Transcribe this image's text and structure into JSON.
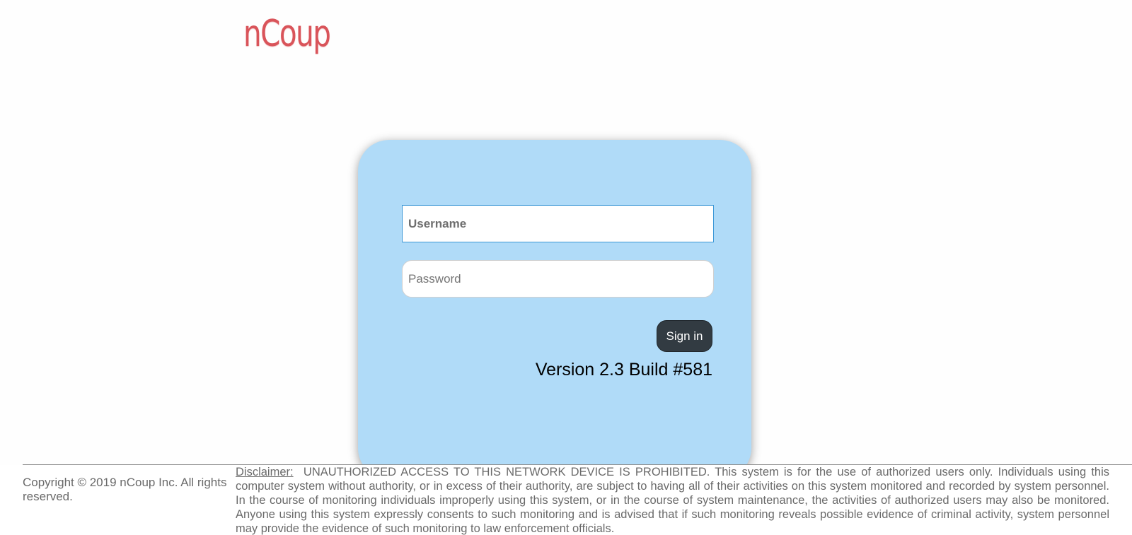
{
  "brand": {
    "logo_text": "nCoup",
    "logo_color": "#d9545a"
  },
  "login": {
    "username_placeholder": "Username",
    "password_placeholder": "Password",
    "signin_label": "Sign in",
    "version_text": "Version 2.3 Build #581",
    "card_color": "#b0dbf8",
    "button_color": "#323b42"
  },
  "footer": {
    "copyright": "Copyright © 2019 nCoup Inc. All rights reserved.",
    "disclaimer_label": "Disclaimer:",
    "disclaimer_text": "UNAUTHORIZED ACCESS TO THIS NETWORK DEVICE IS PROHIBITED.  This system is for the use of authorized users only. Individuals using this computer system without authority, or in excess of their authority, are subject to having all of their activities on this system monitored and recorded by system personnel. In the course of monitoring individuals improperly using this system, or in the course of system maintenance, the activities of authorized users may also be monitored. Anyone using this system expressly consents to such monitoring and is advised that if such monitoring reveals possible evidence of criminal activity, system personnel may provide the evidence of such monitoring to law enforcement officials."
  }
}
